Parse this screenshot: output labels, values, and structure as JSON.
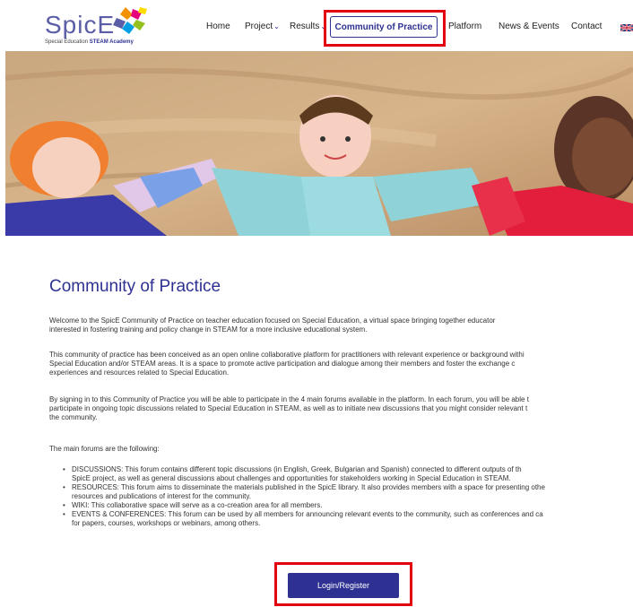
{
  "logo": {
    "word": "SpicE",
    "tagline_pre": "Special Education ",
    "tagline_bold": "STEAM Academy"
  },
  "nav": {
    "home": "Home",
    "project": "Project",
    "results": "Results",
    "active": "Community of Practice",
    "platform": "Platform",
    "news": "News & Events",
    "contact": "Contact"
  },
  "main": {
    "title": "Community of Practice",
    "p1": [
      "Welcome to the SpicE Community of Practice on teacher education focused on Special Education, a virtual space bringing together educator",
      "interested in fostering training and policy change in STEAM for a more inclusive educational system."
    ],
    "p2": [
      "This community of practice has been conceived as an open online collaborative platform for practitioners with relevant experience or background withi",
      "Special Education and/or STEAM areas. It is a space to promote active participation and dialogue among their members and foster the exchange c",
      "experiences and resources related to Special Education."
    ],
    "p3": [
      "By signing in to this Community of Practice you will be able to participate in the 4 main forums available in the platform. In each forum, you will be able t",
      "participate in ongoing topic discussions related to Special Education in STEAM, as well as to initiate new discussions that you might consider relevant t",
      "the community."
    ],
    "p4": "The main forums are the following:",
    "bullets": [
      [
        "DISCUSSIONS: This forum contains different topic discussions (in English, Greek, Bulgarian and Spanish) connected to different outputs of th",
        "SpicE project, as well as general discussions about challenges and opportunities for stakeholders working in Special Education in STEAM."
      ],
      [
        "RESOURCES: This forum aims to disseminate the materials published in the SpicE library. It also provides members with a space for presenting othe",
        "resources and publications of interest for the community."
      ],
      [
        "WIKI: This collaborative space will serve as a co-creation area for all members."
      ],
      [
        "EVENTS & CONFERENCES: This forum can be used by all members for announcing relevant events to the community, such as conferences and ca",
        "for papers, courses, workshops or webinars, among others."
      ]
    ],
    "button": "Login/Register"
  }
}
